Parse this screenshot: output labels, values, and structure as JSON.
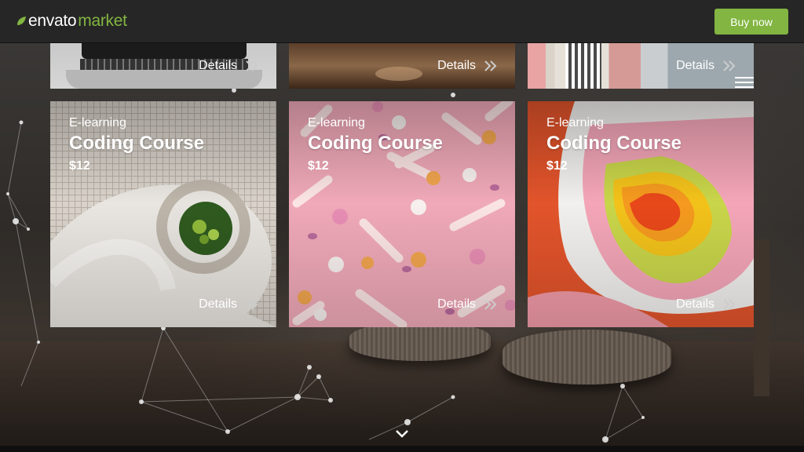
{
  "header": {
    "logo_part1": "envato",
    "logo_part2": "market",
    "buy_label": "Buy now",
    "brand_color": "#82b541"
  },
  "top_cards": [
    {
      "details_label": "Details",
      "image": "laptop-keyboard"
    },
    {
      "details_label": "Details",
      "image": "wooden-table"
    },
    {
      "details_label": "Details",
      "image": "pink-building-door"
    }
  ],
  "cards": [
    {
      "category": "E-learning",
      "title": "Coding Course",
      "price": "$12",
      "details_label": "Details",
      "image": "spiral-staircase"
    },
    {
      "category": "E-learning",
      "title": "Coding Course",
      "price": "$12",
      "details_label": "Details",
      "image": "pink-candy"
    },
    {
      "category": "E-learning",
      "title": "Coding Course",
      "price": "$12",
      "details_label": "Details",
      "image": "colorful-abstract-rings"
    }
  ],
  "icons": {
    "menu": "hamburger-icon",
    "details_arrow": "double-chevron-right-icon",
    "scroll": "chevron-down-icon"
  }
}
